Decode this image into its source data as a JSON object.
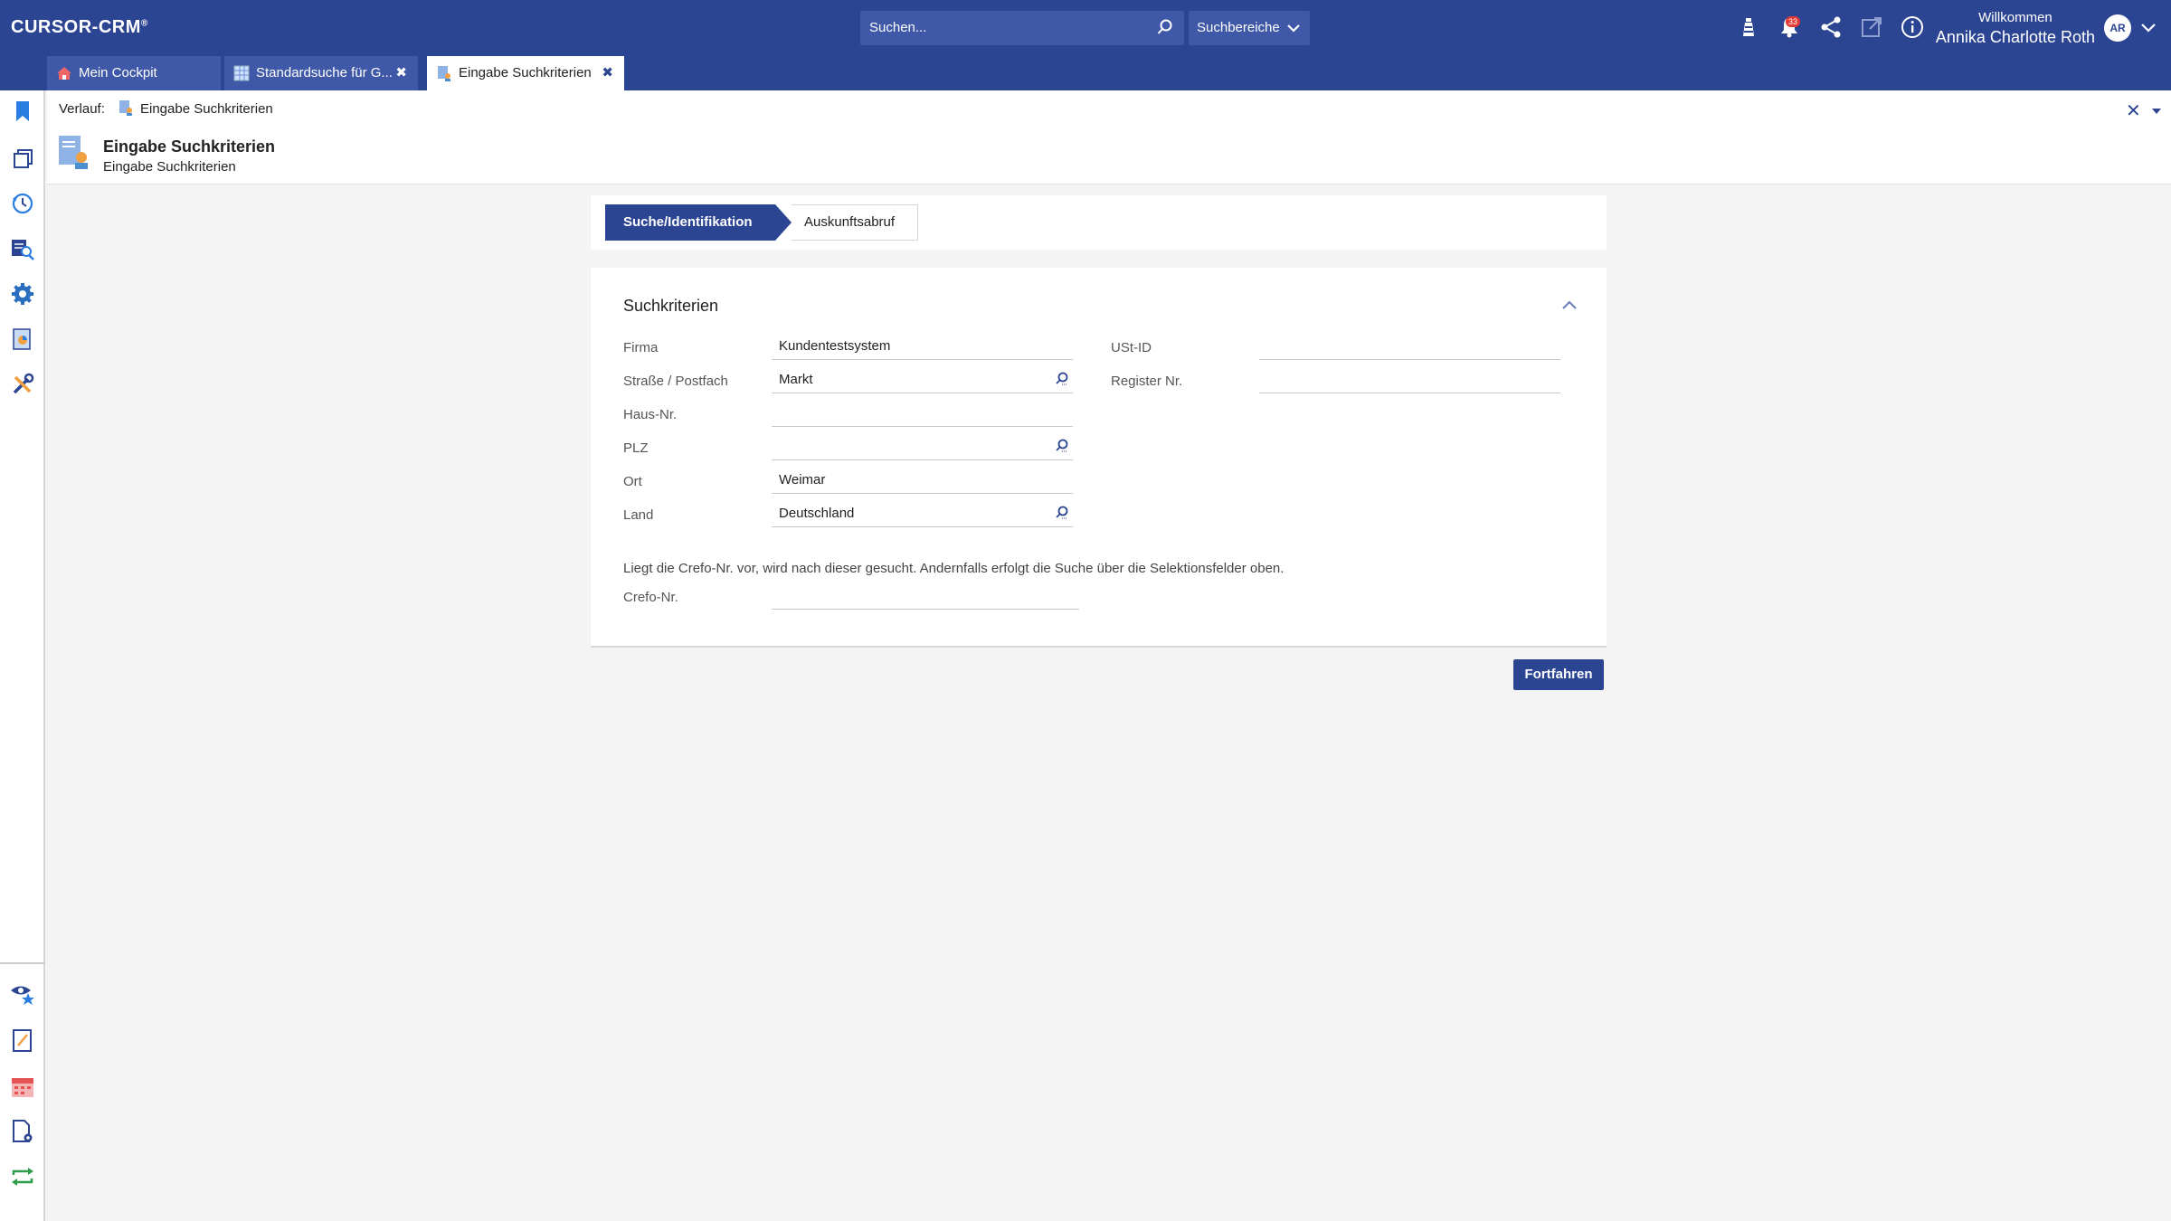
{
  "app": {
    "logo": "CURSOR-CRM",
    "logo_mark": "®"
  },
  "topbar": {
    "search_placeholder": "Suchen...",
    "search_area": "Suchbereiche",
    "notification_count": "33",
    "welcome": "Willkommen",
    "user_name": "Annika Charlotte Roth",
    "user_initials": "AR",
    "icons": [
      "lighthouse-icon",
      "bell-icon",
      "share-icon",
      "external-link-icon",
      "info-icon",
      "chevron-down-icon"
    ]
  },
  "tabs": [
    {
      "label": "Mein Cockpit",
      "icon": "home-icon"
    },
    {
      "label": "Standardsuche für G...",
      "icon": "table-icon"
    },
    {
      "label": "Eingabe Suchkriterien",
      "icon": "search-form-icon"
    }
  ],
  "sidebar": {
    "top_icons": [
      "bookmark-icon",
      "copy-icon",
      "history-icon",
      "search-list-icon",
      "settings-icon",
      "report-icon",
      "tools-icon"
    ],
    "bottom_icons": [
      "watch-star-icon",
      "edit-note-icon",
      "calendar-icon",
      "document-settings-icon",
      "sync-icon"
    ]
  },
  "header": {
    "verlauf_label": "Verlauf:",
    "breadcrumb": "Eingabe Suchkriterien",
    "title": "Eingabe Suchkriterien",
    "subtitle": "Eingabe Suchkriterien"
  },
  "steps": [
    {
      "label": "Suche/Identifikation",
      "active": true
    },
    {
      "label": "Auskunftsabruf",
      "active": false
    }
  ],
  "form": {
    "section_title": "Suchkriterien",
    "fields_left": [
      {
        "label": "Firma",
        "value": "Kundentestsystem",
        "lookup": false
      },
      {
        "label": "Straße / Postfach",
        "value": "Markt",
        "lookup": true
      },
      {
        "label": "Haus-Nr.",
        "value": "",
        "lookup": false
      },
      {
        "label": "PLZ",
        "value": "",
        "lookup": true
      },
      {
        "label": "Ort",
        "value": "Weimar",
        "lookup": false
      },
      {
        "label": "Land",
        "value": "Deutschland",
        "lookup": true
      }
    ],
    "fields_right": [
      {
        "label": "USt-ID",
        "value": ""
      },
      {
        "label": "Register Nr.",
        "value": ""
      }
    ],
    "hint": "Liegt die Crefo-Nr. vor, wird nach dieser gesucht. Andernfalls erfolgt die Suche über die Selektionsfelder oben.",
    "crefo_label": "Crefo-Nr.",
    "crefo_value": ""
  },
  "actions": {
    "continue_label": "Fortfahren"
  },
  "colors": {
    "primary": "#2c4592",
    "primary_light": "#3f59a8",
    "badge": "#e53935"
  }
}
